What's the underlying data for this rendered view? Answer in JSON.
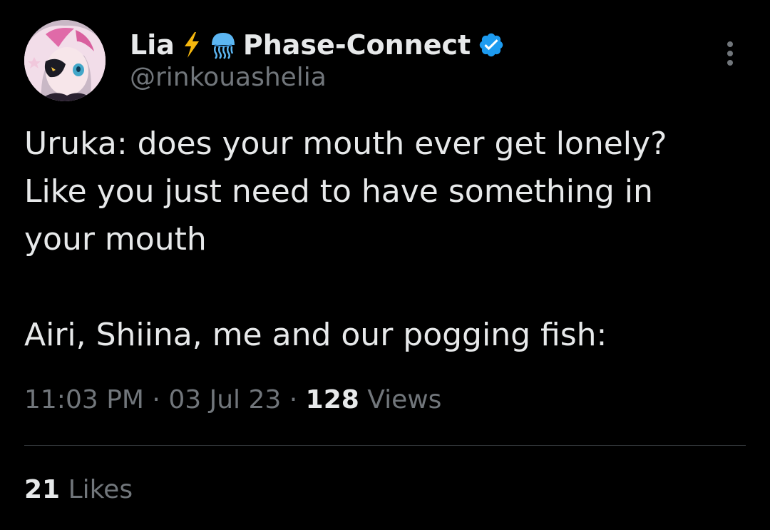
{
  "author": {
    "display_name": "Lia",
    "emoji_1": "lightning-emoji",
    "emoji_2": "jellyfish-emoji",
    "org_name": "Phase-Connect",
    "verified_badge": "verified-badge-icon",
    "handle": "@rinkouashelia",
    "avatar": "avatar-anime-character"
  },
  "tweet": {
    "text": "Uruka: does your mouth ever get lonely?\nLike you just need to have something in\nyour mouth\n\nAiri, Shiina, me and our pogging fish:",
    "time": "11:03 PM",
    "separator": "·",
    "date": "03 Jul 23",
    "views_count": "128",
    "views_label": "Views"
  },
  "engagement": {
    "likes_count": "21",
    "likes_label": "Likes"
  },
  "icons": {
    "more": "more-vertical-icon"
  },
  "colors": {
    "background": "#000000",
    "primary_text": "#e7e9ea",
    "secondary_text": "#71767b",
    "verified_blue": "#1d9bf0",
    "lightning_yellow": "#f5b70e",
    "jellyfish_blue": "#5cb6f2",
    "divider": "#2f3336"
  }
}
